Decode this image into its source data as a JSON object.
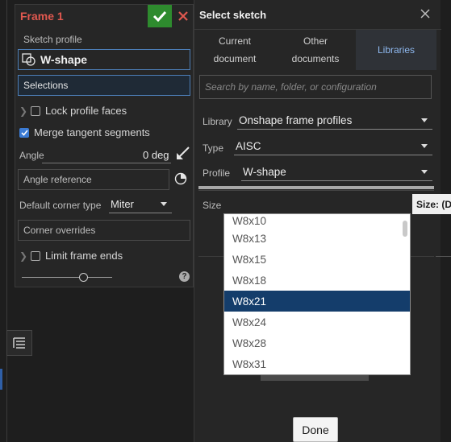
{
  "frame": {
    "title": "Frame 1",
    "sketch_profile_label": "Sketch profile",
    "sketch_profile_value": "W-shape",
    "selections_label": "Selections",
    "lock_profile_faces_label": "Lock profile faces",
    "lock_profile_faces_checked": false,
    "merge_tangent_label": "Merge tangent segments",
    "merge_tangent_checked": true,
    "angle_label": "Angle",
    "angle_value": "0 deg",
    "angle_reference_label": "Angle reference",
    "default_corner_label": "Default corner type",
    "default_corner_value": "Miter",
    "corner_overrides_label": "Corner overrides",
    "limit_frame_ends_label": "Limit frame ends",
    "limit_frame_ends_checked": false,
    "slider_fraction": 0.64
  },
  "dialog": {
    "title": "Select sketch",
    "tabs": [
      {
        "label_line1": "Current",
        "label_line2": "document"
      },
      {
        "label_line1": "Other",
        "label_line2": "documents"
      },
      {
        "label_line1": "Libraries",
        "label_line2": ""
      }
    ],
    "active_tab": "Libraries",
    "search_placeholder": "Search by name, folder, or configuration",
    "library_label": "Library",
    "library_value": "Onshape frame profiles",
    "type_label": "Type",
    "type_value": "AISC",
    "profile_label": "Profile",
    "profile_value": "W-shape",
    "size_label": "Size",
    "size_options": [
      "W8x10",
      "W8x13",
      "W8x15",
      "W8x18",
      "W8x21",
      "W8x24",
      "W8x28",
      "W8x31"
    ],
    "size_selected": "W8x21",
    "done_label": "Done",
    "tooltip_text": "Size: (De"
  },
  "colors": {
    "accent_blue": "#4d7fb8",
    "confirm_green": "#2e8b2e",
    "cancel_red": "#e0584f",
    "selected_row": "#143d6b"
  }
}
